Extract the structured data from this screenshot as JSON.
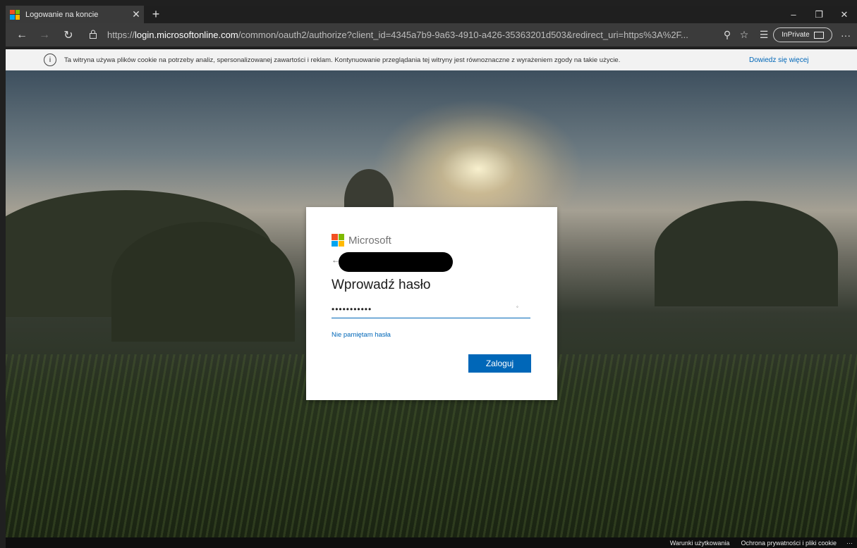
{
  "browser": {
    "tab": {
      "title": "Logowanie na koncie"
    },
    "url": {
      "scheme": "https://",
      "host": "login.microsoftonline.com",
      "path": "/common/oauth2/authorize?client_id=4345a7b9-9a63-4910-a426-35363201d503&redirect_uri=https%3A%2F..."
    },
    "inprivate_label": "InPrivate",
    "icons": {
      "new_tab": "+",
      "minimize": "–",
      "restore": "❐",
      "close": "✕",
      "back": "←",
      "forward": "→",
      "refresh": "↻",
      "lock": "🔒",
      "reader": "⚲",
      "favorite": "☆",
      "favorites_hub": "☰",
      "more": "···"
    }
  },
  "cookie_notice": {
    "text": "Ta witryna używa plików cookie na potrzeby analiz, spersonalizowanej zawartości i reklam. Kontynuowanie przeglądania tej witryny jest równoznaczne z wyrażeniem zgody na takie użycie.",
    "link": "Dowiedz się więcej",
    "info_glyph": "i"
  },
  "signin": {
    "brand": "Microsoft",
    "back_glyph": "←",
    "heading": "Wprowadź hasło",
    "password_value": "•••••••••••",
    "reveal_glyph": "◦",
    "forgot_link": "Nie pamiętam hasła",
    "submit_label": "Zaloguj"
  },
  "footer": {
    "terms": "Warunki użytkowania",
    "privacy": "Ochrona prywatności i pliki cookie",
    "more": "···"
  },
  "colors": {
    "accent": "#0067b8",
    "ms_red": "#f25022",
    "ms_green": "#7fba00",
    "ms_blue": "#00a4ef",
    "ms_yellow": "#ffb900"
  }
}
